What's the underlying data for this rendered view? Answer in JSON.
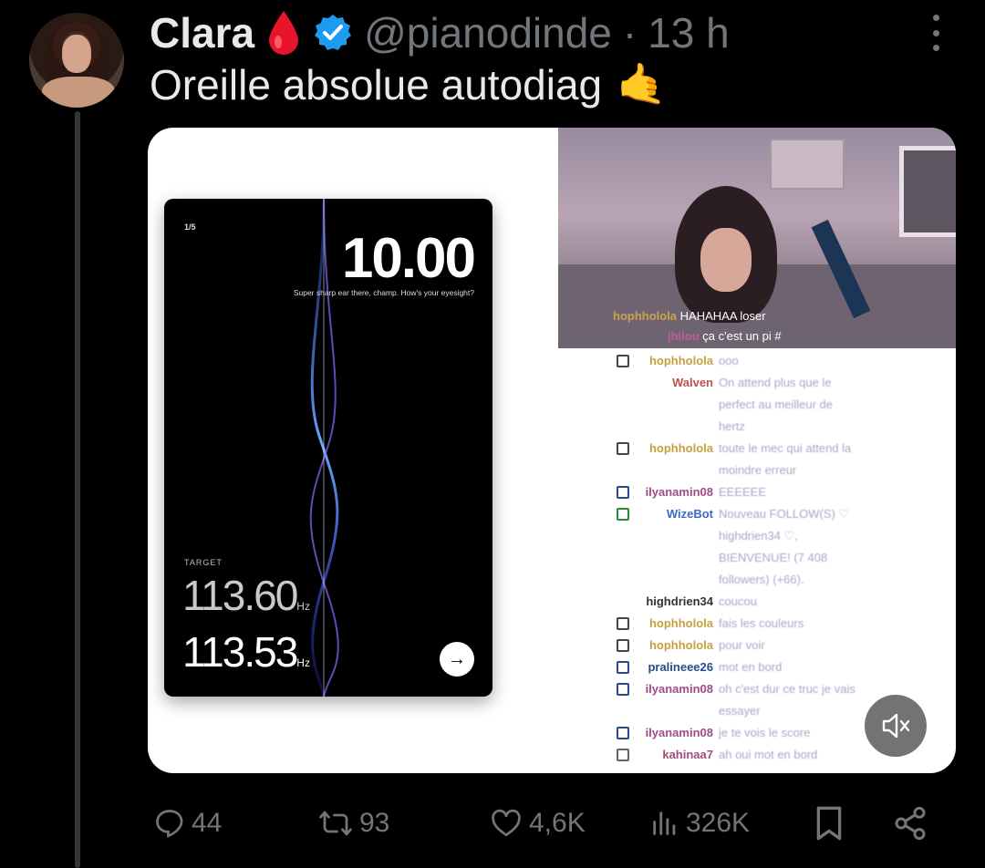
{
  "tweet": {
    "author_name": "Clara",
    "handle": "@pianodinde",
    "separator": "·",
    "time": "13 h",
    "text": "Oreille absolue autodiag",
    "emoji": "🤙"
  },
  "media": {
    "phone": {
      "counter": "1/5",
      "score": "10.00",
      "blurb": "Super sharp ear there, champ. How's your eyesight?",
      "target_label": "TARGET",
      "target_value": "113.60",
      "actual_value": "113.53",
      "unit": "Hz",
      "next_label": "→"
    },
    "chat_overlay": [
      {
        "user": "hophholola",
        "message": "HAHAHAA loser"
      },
      {
        "user": "jhilou",
        "message": "ça c'est un pi #"
      }
    ],
    "chat": [
      {
        "user": "hophholola",
        "message": "ooo",
        "color": "#c8a040",
        "badge": "#444"
      },
      {
        "user": "Walven",
        "message": "On attend plus que le",
        "color": "#c0504a",
        "badge": ""
      },
      {
        "user": "",
        "message": "perfect au meilleur de",
        "color": "",
        "badge": ""
      },
      {
        "user": "",
        "message": "hertz",
        "color": "",
        "badge": ""
      },
      {
        "user": "hophholola",
        "message": "toute le mec qui attend la",
        "color": "#c8a040",
        "badge": "#444"
      },
      {
        "user": "",
        "message": "moindre erreur",
        "color": "",
        "badge": ""
      },
      {
        "user": "ilyanamin08",
        "message": "EEEEEE",
        "color": "#a04a8a",
        "badge": "#2a4a8a"
      },
      {
        "user": "WizeBot",
        "message": "Nouveau FOLLOW(S) ♡",
        "color": "#3a6ac8",
        "badge": "#2a8a3a"
      },
      {
        "user": "",
        "message": "highdrien34 ♡,",
        "color": "",
        "badge": ""
      },
      {
        "user": "",
        "message": "BIENVENUE! (7 408",
        "color": "",
        "badge": ""
      },
      {
        "user": "",
        "message": "followers) (+66).",
        "color": "",
        "badge": ""
      },
      {
        "user": "highdrien34",
        "message": "coucou",
        "color": "#333",
        "badge": ""
      },
      {
        "user": "hophholola",
        "message": "fais les couleurs",
        "color": "#c8a040",
        "badge": "#444"
      },
      {
        "user": "hophholola",
        "message": "pour voir",
        "color": "#c8a040",
        "badge": "#444"
      },
      {
        "user": "pralineee26",
        "message": "mot en bord",
        "color": "#2a4a8a",
        "badge": "#2a4a8a"
      },
      {
        "user": "ilyanamin08",
        "message": "oh c'est dur ce truc je vais",
        "color": "#a04a8a",
        "badge": "#2a4a8a"
      },
      {
        "user": "",
        "message": "essayer",
        "color": "",
        "badge": ""
      },
      {
        "user": "ilyanamin08",
        "message": "je te vois le score",
        "color": "#a04a8a",
        "badge": "#2a4a8a"
      },
      {
        "user": "kahinaa7",
        "message": "ah oui mot en bord",
        "color": "#a0507a",
        "badge": "#666"
      }
    ]
  },
  "actions": {
    "replies": "44",
    "retweets": "93",
    "likes": "4,6K",
    "views": "326K"
  },
  "colors": {
    "muted": "#71767b",
    "verified": "#1d9bf0",
    "blood": "#e8142c"
  }
}
